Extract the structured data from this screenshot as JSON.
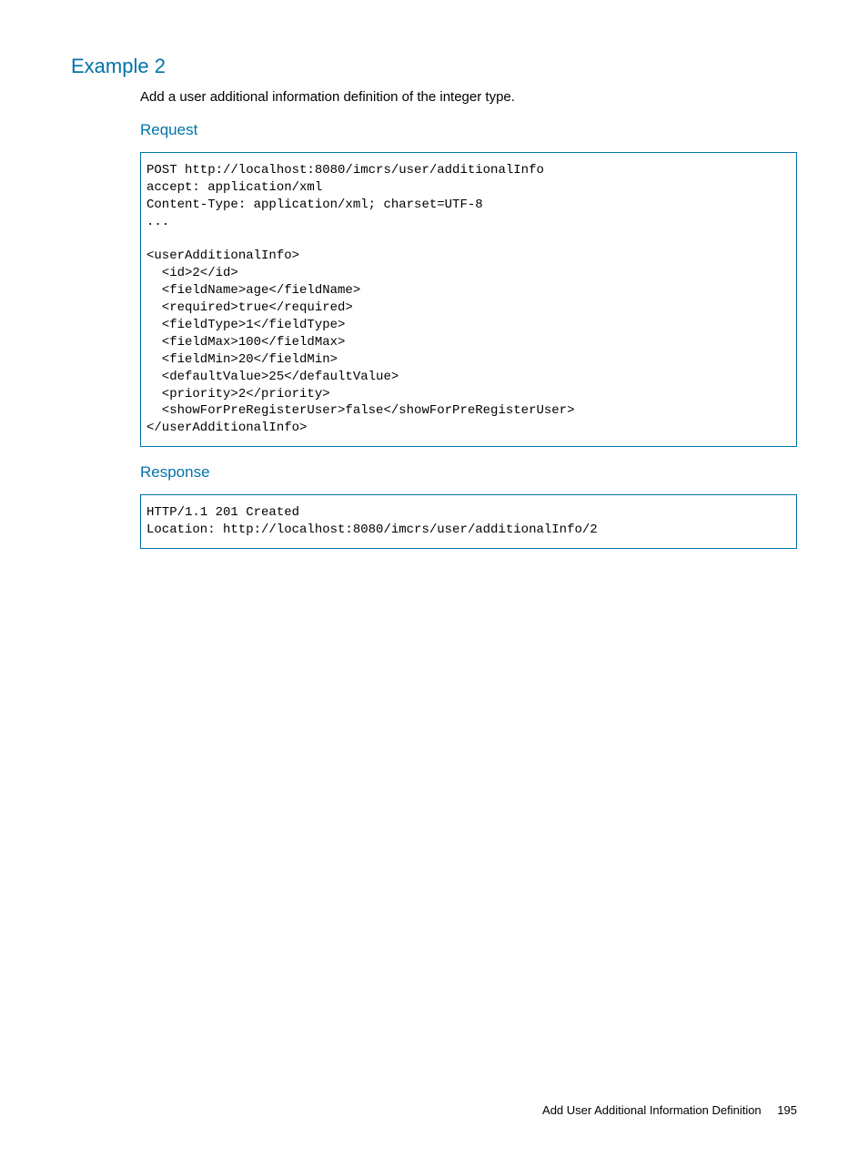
{
  "heading": "Example 2",
  "intro": "Add a user additional information definition of the integer type.",
  "request": {
    "label": "Request",
    "code": "POST http://localhost:8080/imcrs/user/additionalInfo\naccept: application/xml\nContent-Type: application/xml; charset=UTF-8\n...\n\n<userAdditionalInfo>\n  <id>2</id>\n  <fieldName>age</fieldName>\n  <required>true</required>\n  <fieldType>1</fieldType>\n  <fieldMax>100</fieldMax>\n  <fieldMin>20</fieldMin>\n  <defaultValue>25</defaultValue>\n  <priority>2</priority>\n  <showForPreRegisterUser>false</showForPreRegisterUser>\n</userAdditionalInfo>"
  },
  "response": {
    "label": "Response",
    "code": "HTTP/1.1 201 Created\nLocation: http://localhost:8080/imcrs/user/additionalInfo/2"
  },
  "footer": {
    "title": "Add User Additional Information Definition",
    "page": "195"
  }
}
